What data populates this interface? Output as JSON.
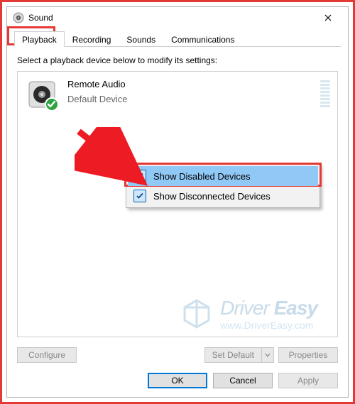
{
  "window": {
    "title": "Sound",
    "close_label": "Close"
  },
  "tabs": [
    {
      "label": "Playback",
      "active": true
    },
    {
      "label": "Recording",
      "active": false
    },
    {
      "label": "Sounds",
      "active": false
    },
    {
      "label": "Communications",
      "active": false
    }
  ],
  "instruction": "Select a playback device below to modify its settings:",
  "devices": [
    {
      "name": "Remote Audio",
      "status": "Default Device",
      "is_default": true
    }
  ],
  "context_menu": {
    "items": [
      {
        "label": "Show Disabled Devices",
        "checked": true,
        "selected": true
      },
      {
        "label": "Show Disconnected Devices",
        "checked": true,
        "selected": false
      }
    ]
  },
  "buttons": {
    "configure": "Configure",
    "set_default": "Set Default",
    "properties": "Properties",
    "ok": "OK",
    "cancel": "Cancel",
    "apply": "Apply"
  },
  "watermark": {
    "line1_light": "Driver",
    "line1_bold": "Easy",
    "line2": "www.DriverEasy.com"
  },
  "annotation": {
    "tab_highlight": "playback-tab-highlight",
    "menu_highlight": "show-disabled-highlight",
    "arrow": "red-arrow-annotation"
  }
}
